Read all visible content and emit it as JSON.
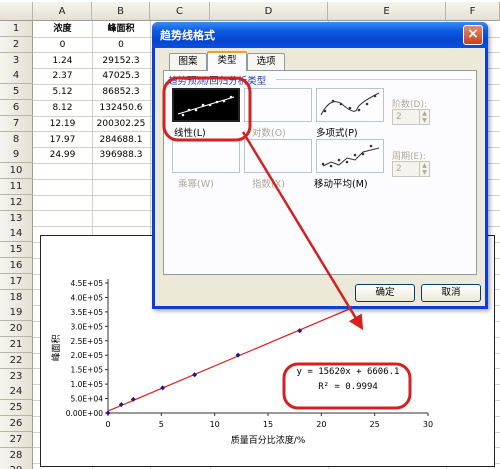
{
  "spreadsheet": {
    "columns": [
      "A",
      "B",
      "C",
      "D",
      "E",
      "F"
    ],
    "rows": [
      "1",
      "2",
      "3",
      "4",
      "5",
      "6",
      "7",
      "8",
      "9",
      "10",
      "11",
      "12",
      "13",
      "14",
      "15",
      "16",
      "17",
      "18",
      "19",
      "20",
      "21",
      "22",
      "23",
      "24",
      "25",
      "26",
      "27",
      "28",
      "29"
    ],
    "header_a": "浓度",
    "header_b": "峰面积",
    "data": [
      [
        "0",
        "0"
      ],
      [
        "1.24",
        "29152.3"
      ],
      [
        "2.37",
        "47025.3"
      ],
      [
        "5.12",
        "86852.3"
      ],
      [
        "8.12",
        "132450.6"
      ],
      [
        "12.19",
        "200302.25"
      ],
      [
        "17.97",
        "284688.1"
      ],
      [
        "24.99",
        "396988.3"
      ]
    ]
  },
  "dialog": {
    "title": "趋势线格式",
    "close": "×",
    "tabs": [
      "图案",
      "类型",
      "选项"
    ],
    "active_tab": "类型",
    "section_label": "趋势预测/回归分析类型",
    "types": [
      {
        "label": "线性(L)",
        "enabled": true,
        "selected": true
      },
      {
        "label": "对数(O)",
        "enabled": false,
        "selected": false
      },
      {
        "label": "多项式(P)",
        "enabled": true,
        "selected": false
      },
      {
        "label": "乘幂(W)",
        "enabled": false,
        "selected": false
      },
      {
        "label": "指数(X)",
        "enabled": false,
        "selected": false
      },
      {
        "label": "移动平均(M)",
        "enabled": true,
        "selected": false
      }
    ],
    "order_label": "阶数(D):",
    "order_value": "2",
    "period_label": "周期(E):",
    "period_value": "2",
    "ok": "确定",
    "cancel": "取消"
  },
  "chart_data": {
    "type": "scatter",
    "title": "",
    "xlabel": "质量百分比浓度/%",
    "ylabel": "峰面积",
    "x_ticks": [
      "0",
      "5",
      "10",
      "15",
      "20",
      "25",
      "30"
    ],
    "y_ticks": [
      "0.00E+00",
      "5.0E+04",
      "1.0E+05",
      "1.5E+05",
      "2.0E+05",
      "2.5E+05",
      "3.0E+05",
      "3.5E+05",
      "4.0E+05",
      "4.5E+05"
    ],
    "xlim": [
      0,
      30
    ],
    "ylim": [
      0,
      450000
    ],
    "x": [
      0,
      1.24,
      2.37,
      5.12,
      8.12,
      12.19,
      17.97,
      24.99
    ],
    "y": [
      0,
      29152.3,
      47025.3,
      86852.3,
      132450.6,
      200302.25,
      284688.1,
      396988.3
    ],
    "trendline": {
      "slope": 15620,
      "intercept": 6606.1
    },
    "equation": "y = 15620x + 6606.1",
    "r2": "R² = 0.9994",
    "colors": {
      "points": "#1a1a8c",
      "trend": "#e02020",
      "highlight": "#d42020"
    }
  }
}
